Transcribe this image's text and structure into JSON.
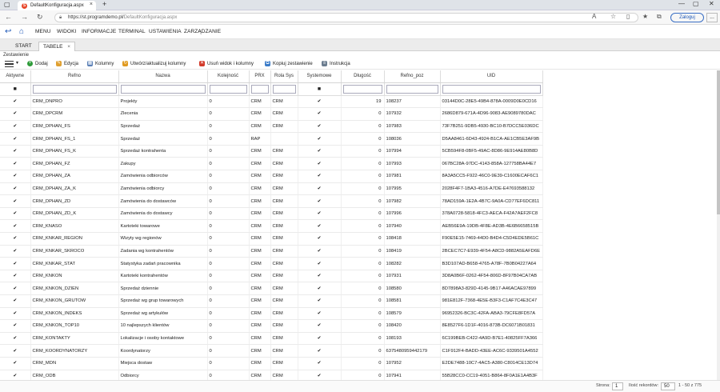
{
  "browser": {
    "tab_title": "DefaultKonfiguracja.aspx",
    "tab_icon_letter": "S",
    "url_host": "https://st.programdemo.pl/",
    "url_path": "DefaultKonfiguracja.aspx",
    "login_label": "Zaloguj",
    "more_label": "..."
  },
  "menu": {
    "items": [
      "MENU",
      "WIDOKI",
      "INFORMACJE",
      "TERMINAL",
      "USTAWIENIA",
      "ZARZĄDZANIE"
    ]
  },
  "app_tabs": {
    "start": "START",
    "tabele": "TABELE",
    "close": "×"
  },
  "section_label": "Zestawienie",
  "toolbar": {
    "add": "Dodaj",
    "edit": "Edycja",
    "columns": "Kolumny",
    "create_update_columns": "Utwórz/aktualizuj kolumny",
    "delete_view": "Usuń widok i kolumny",
    "copy_summary": "Kopiuj zestawienie",
    "instruction": "Instrukcja"
  },
  "table": {
    "headers": [
      "Aktywne",
      "Refno",
      "Nazwa",
      "Kolejność",
      "PRX",
      "Rola Sys",
      "Systemowe",
      "Długość",
      "Refno_poz",
      "UID"
    ],
    "filter_check": "■",
    "rows": [
      [
        "✔",
        "CRM_DNPRO",
        "Projekty",
        "0",
        "CRM",
        "CRM",
        "✔",
        "19",
        "108237",
        "03144D0C-28E5-49B4-878A-0009D0E0CD16"
      ],
      [
        "✔",
        "CRM_DPCRM",
        "Zlecenia",
        "0",
        "CRM",
        "CRM",
        "✔",
        "0",
        "107932",
        "2686D879-671A-4D96-9083-AE9089780DAC"
      ],
      [
        "✔",
        "CRM_DPHAN_FS",
        "Sprzedaż",
        "0",
        "CRM",
        "CRM",
        "✔",
        "0",
        "107983",
        "73F7B251-9DB5-4930-BC10-B7DCC5E036DC"
      ],
      [
        "✔",
        "CRM_DPHAN_FS_1",
        "Sprzedaż",
        "0",
        "RAP",
        "",
        "✔",
        "0",
        "108036",
        "D5AA8461-6D43-4924-B1CA-AE1CB5E3AF9B"
      ],
      [
        "✔",
        "CRM_DPHAN_FS_K",
        "Sprzedaż kontrahenta",
        "0",
        "CRM",
        "CRM",
        "✔",
        "0",
        "107994",
        "5CB594F8-0BF5-49AC-8D86-9E914AE80B8D"
      ],
      [
        "✔",
        "CRM_DPHAN_FZ",
        "Zakupy",
        "0",
        "CRM",
        "CRM",
        "✔",
        "0",
        "107993",
        "067BC28A-97DC-4143-858A-127758BA44E7"
      ],
      [
        "✔",
        "CRM_DPHAN_ZA",
        "Zamówienia odbiorców",
        "0",
        "CRM",
        "CRM",
        "✔",
        "0",
        "107981",
        "8A3A5CC5-F922-46C0-9E39-C1600ECAF6C1"
      ],
      [
        "✔",
        "CRM_DPHAN_ZA_K",
        "Zamówienia odbiorcy",
        "0",
        "CRM",
        "CRM",
        "✔",
        "0",
        "107995",
        "2028F4F7-1BA3-4516-A7DE-E47693588132"
      ],
      [
        "✔",
        "CRM_DPHAN_ZD",
        "Zamówienia do dostawców",
        "0",
        "CRM",
        "CRM",
        "✔",
        "0",
        "107982",
        "78AD159A-1E2A-4B7C-9A0A-CD77EF6DC811"
      ],
      [
        "✔",
        "CRM_DPHAN_ZD_K",
        "Zamówienia do dostawcy",
        "0",
        "CRM",
        "CRM",
        "✔",
        "0",
        "107996",
        "378A0728-5818-4FC3-AECA-F42A7AEF2FC8"
      ],
      [
        "✔",
        "CRM_KNASO",
        "Kartoteki towarowe",
        "0",
        "CRM",
        "CRM",
        "✔",
        "0",
        "107940",
        "AEB56E9A-19DB-4F8E-AD3B-4E6B6658515B"
      ],
      [
        "✔",
        "CRM_KNKAR_REGION",
        "Wizyty wg regionów",
        "0",
        "CRM",
        "CRM",
        "✔",
        "0",
        "108418",
        "F90E5E15-7469-44D0-B4D4-C5D4EDE5B61C"
      ],
      [
        "✔",
        "CRM_KNKAR_SKROCO",
        "Zadania wg kontrahentów",
        "0",
        "CRM",
        "CRM",
        "✔",
        "0",
        "108419",
        "2BCEC7C7-E939-4F54-A8CD-9882A5EAFD6E"
      ],
      [
        "✔",
        "CRM_KNKAR_STAT",
        "Statystyka zadań pracownika",
        "0",
        "CRM",
        "CRM",
        "✔",
        "0",
        "108282",
        "B3D107AD-B658-4765-A78F-7B0B04227A64"
      ],
      [
        "✔",
        "CRM_KNKON",
        "Kartoteki kontrahentów",
        "0",
        "CRM",
        "CRM",
        "✔",
        "0",
        "107931",
        "3D8A0B6F-0262-4F54-806D-8F97B04CA7AB"
      ],
      [
        "✔",
        "CRM_KNKON_DZIEN",
        "Sprzedaż dziennie",
        "0",
        "CRM",
        "CRM",
        "✔",
        "0",
        "108580",
        "8D7898A3-829D-4145-9B17-A46ACAE97899"
      ],
      [
        "✔",
        "CRM_KNKON_GRUTOW",
        "Sprzedaż wg grup towarowych",
        "0",
        "CRM",
        "CRM",
        "✔",
        "0",
        "108581",
        "981E812F-7368-4E5E-B3F3-C1AF7C4E3C47"
      ],
      [
        "✔",
        "CRM_KNKON_INDEKS",
        "Sprzedaż wg artykułów",
        "0",
        "CRM",
        "CRM",
        "✔",
        "0",
        "108579",
        "96952326-BC3C-42FA-ABA3-79CFE8FD57A"
      ],
      [
        "✔",
        "CRM_KNKON_TOP10",
        "10 najlepszych klientów",
        "0",
        "CRM",
        "CRM",
        "✔",
        "0",
        "108420",
        "8E8527F6-1D1F-4016-873B-DC6071B01831"
      ],
      [
        "✔",
        "CRM_KONTAKTY",
        "Lokalizacje i osoby kontaktowe",
        "0",
        "CRM",
        "CRM",
        "✔",
        "0",
        "108193",
        "6C199BEB-C422-4A9D-B7E1-40825FF7A366"
      ],
      [
        "✔",
        "CRM_KOORDYNATORZY",
        "Koordynatorzy",
        "0",
        "CRM",
        "CRM",
        "✔",
        "0",
        "6375480959442179",
        "C1F912F4-BADD-43EE-AC6C-9339501A4552"
      ],
      [
        "✔",
        "CRM_MDN",
        "Miejsca dostaw",
        "0",
        "CRM",
        "CRM",
        "✔",
        "0",
        "107952",
        "E2DE7488-10C7-4AC5-A380-C8014CE13D74"
      ],
      [
        "✔",
        "CRM_ODB",
        "Odbiorcy",
        "0",
        "CRM",
        "CRM",
        "✔",
        "0",
        "107941",
        "55B28CC0-CC19-4051-B864-8F0A1E1A4B3F"
      ]
    ]
  },
  "status": {
    "page_label": "Strona:",
    "page_value": "1",
    "records_label": "Ilość rekordów:",
    "records_value": "50",
    "range_text": "1 - 50 z 775"
  },
  "colors": {
    "accent": "#1d57b7",
    "tab_icon": "#e8472a",
    "add_icon": "#2e9b3a",
    "delete_icon": "#d23a2a"
  }
}
